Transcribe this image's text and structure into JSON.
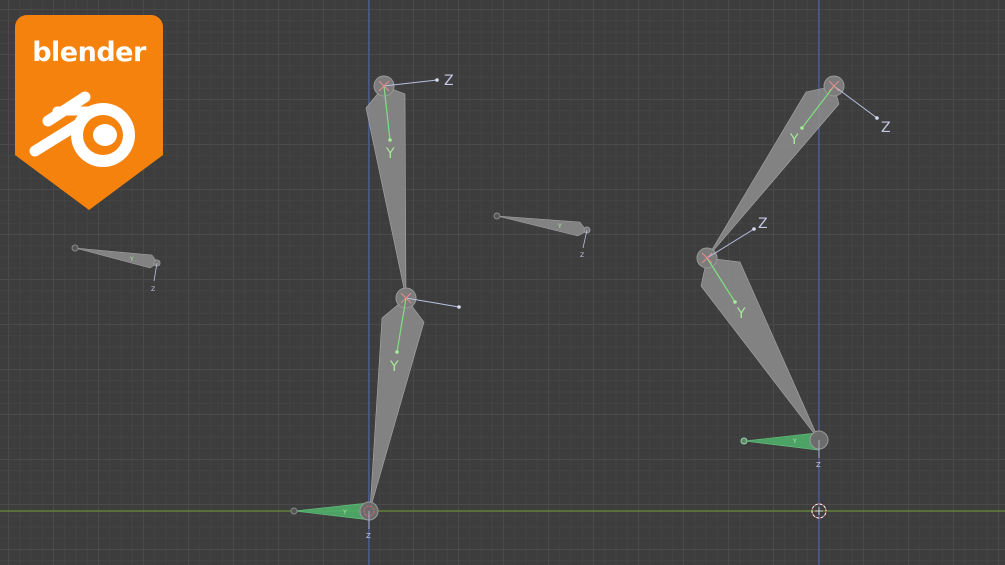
{
  "app": {
    "logo_text": "blender",
    "logo_color": "#f5820d"
  },
  "viewport": {
    "background_color": "#3d3d3d",
    "grid_color": "#4a4a4a",
    "x_axis_color": "#6b8c3a",
    "y_axis_color": "#4a62a8"
  },
  "axis_labels": {
    "z": "Z",
    "y": "Y"
  },
  "colors": {
    "bone_fill": "#8e8e8e",
    "bone_selected_fill": "#4fae6a",
    "y_axis_line": "#7ee07e",
    "z_axis_line": "#b9bfe0",
    "z_label": "#c5c9e6",
    "y_label": "#a8e89a"
  }
}
